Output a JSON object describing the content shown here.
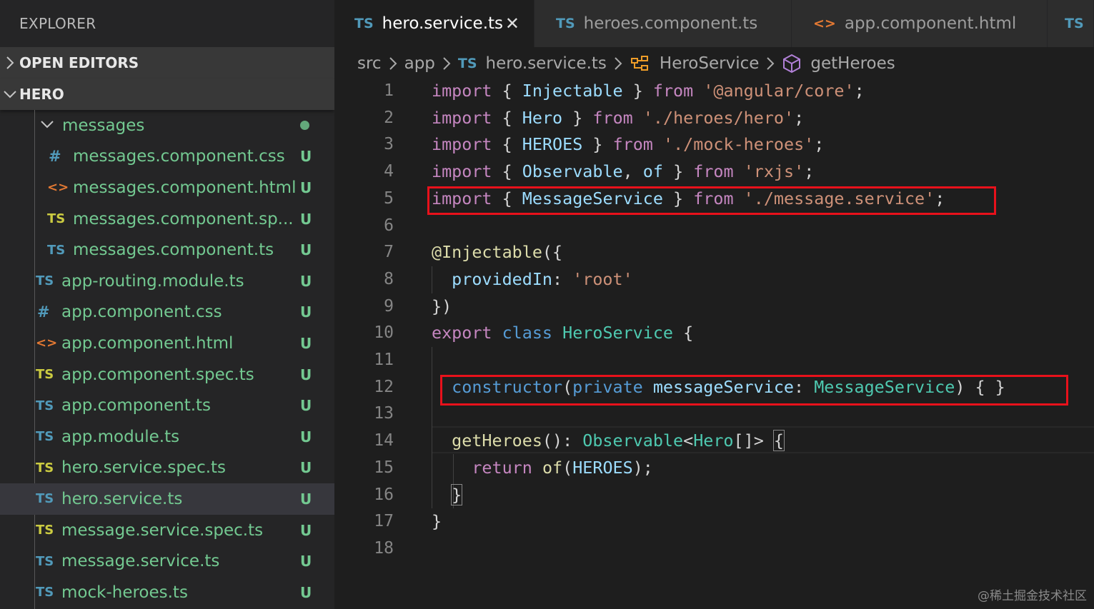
{
  "sidebar": {
    "title": "EXPLORER",
    "sections": {
      "open_editors": "OPEN EDITORS",
      "project": "HERO"
    },
    "items": [
      {
        "icon": "chevron-down-icon",
        "name": "messages",
        "status": "dot",
        "color": "#73c991"
      },
      {
        "icon": "#",
        "name": "messages.component.css",
        "status": "U"
      },
      {
        "icon": "<>",
        "name": "messages.component.html",
        "status": "U"
      },
      {
        "icon": "TS",
        "name": "messages.component.sp...",
        "status": "U"
      },
      {
        "icon": "TS",
        "name": "messages.component.ts",
        "status": "U"
      },
      {
        "icon": "TS",
        "name": "app-routing.module.ts",
        "status": "U"
      },
      {
        "icon": "#",
        "name": "app.component.css",
        "status": "U"
      },
      {
        "icon": "<>",
        "name": "app.component.html",
        "status": "U"
      },
      {
        "icon": "TS",
        "name": "app.component.spec.ts",
        "status": "U"
      },
      {
        "icon": "TS",
        "name": "app.component.ts",
        "status": "U"
      },
      {
        "icon": "TS",
        "name": "app.module.ts",
        "status": "U"
      },
      {
        "icon": "TS",
        "name": "hero.service.spec.ts",
        "status": "U"
      },
      {
        "icon": "TS",
        "name": "hero.service.ts",
        "status": "U",
        "active": true
      },
      {
        "icon": "TS",
        "name": "message.service.spec.ts",
        "status": "U"
      },
      {
        "icon": "TS",
        "name": "message.service.ts",
        "status": "U"
      },
      {
        "icon": "TS",
        "name": "mock-heroes.ts",
        "status": "U"
      }
    ]
  },
  "tabs": [
    {
      "icon": "TS",
      "label": "hero.service.ts",
      "active": true,
      "close": "✕"
    },
    {
      "icon": "TS",
      "label": "heroes.component.ts"
    },
    {
      "icon": "<>",
      "label": "app.component.html"
    },
    {
      "icon": "TS",
      "label": ""
    }
  ],
  "breadcrumb": {
    "parts": [
      "src",
      "app",
      "hero.service.ts",
      "HeroService",
      "getHeroes"
    ],
    "file_icon": "TS"
  },
  "code": {
    "line_numbers": [
      "1",
      "2",
      "3",
      "4",
      "5",
      "6",
      "7",
      "8",
      "9",
      "10",
      "11",
      "12",
      "13",
      "14",
      "15",
      "16",
      "17",
      "18"
    ],
    "lines": [
      "import { Injectable } from '@angular/core';",
      "import { Hero } from './heroes/hero';",
      "import { HEROES } from './mock-heroes';",
      "import { Observable, of } from 'rxjs';",
      "import { MessageService } from './message.service';",
      "",
      "@Injectable({",
      "  providedIn: 'root'",
      "})",
      "export class HeroService {",
      "",
      "  constructor(private messageService: MessageService) { }",
      "",
      "  getHeroes(): Observable<Hero[]> {",
      "    return of(HEROES);",
      "  }",
      "}",
      ""
    ],
    "highlighted_lines": [
      5,
      12
    ]
  },
  "watermark": "@稀土掘金技术社区",
  "colors": {
    "highlight_box": "#e8111b",
    "git_untracked": "#73c991",
    "ts_icon": "#519aba",
    "ts_spec_icon": "#cbcb41",
    "html_icon": "#e37933",
    "css_icon": "#519aba"
  }
}
